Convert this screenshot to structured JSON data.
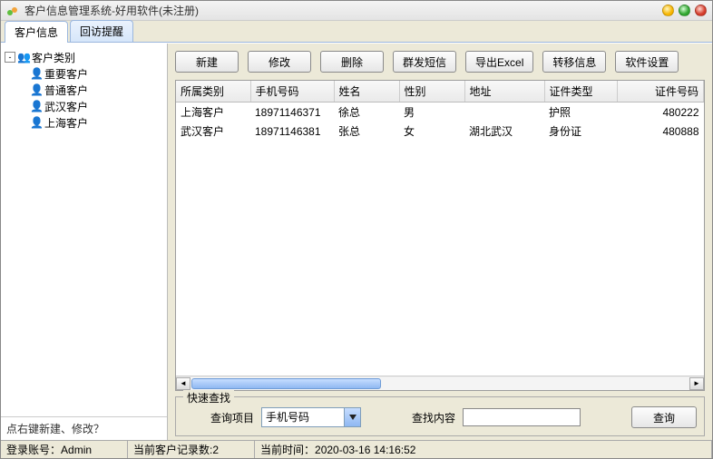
{
  "window": {
    "title": "客户信息管理系统-好用软件(未注册)"
  },
  "tabs": [
    {
      "label": "客户信息",
      "active": true
    },
    {
      "label": "回访提醒",
      "active": false
    }
  ],
  "tree": {
    "root": "客户类别",
    "items": [
      {
        "label": "重要客户"
      },
      {
        "label": "普通客户"
      },
      {
        "label": "武汉客户"
      },
      {
        "label": "上海客户"
      }
    ]
  },
  "left_hint": "点右键新建、修改？",
  "toolbar": {
    "new_label": "新建",
    "edit_label": "修改",
    "delete_label": "删除",
    "sms_label": "群发短信",
    "export_label": "导出Excel",
    "transfer_label": "转移信息",
    "settings_label": "软件设置"
  },
  "columns": [
    "所属类别",
    "手机号码",
    "姓名",
    "性别",
    "地址",
    "证件类型",
    "证件号码"
  ],
  "rows": [
    {
      "category": "上海客户",
      "phone": "18971146371",
      "name": "徐总",
      "gender": "男",
      "address": "",
      "id_type": "护照",
      "id_no": "480222"
    },
    {
      "category": "武汉客户",
      "phone": "18971146381",
      "name": "张总",
      "gender": "女",
      "address": "湖北武汉",
      "id_type": "身份证",
      "id_no": "480888"
    }
  ],
  "search": {
    "legend": "快速查找",
    "field_label": "查询项目",
    "field_value": "手机号码",
    "content_label": "查找内容",
    "content_value": "",
    "button_label": "查询"
  },
  "status": {
    "account_label": "登录账号：",
    "account_value": "Admin",
    "count_label": "当前客户记录数:",
    "count_value": "2",
    "time_label": "当前时间：",
    "time_value": "2020-03-16 14:16:52"
  }
}
